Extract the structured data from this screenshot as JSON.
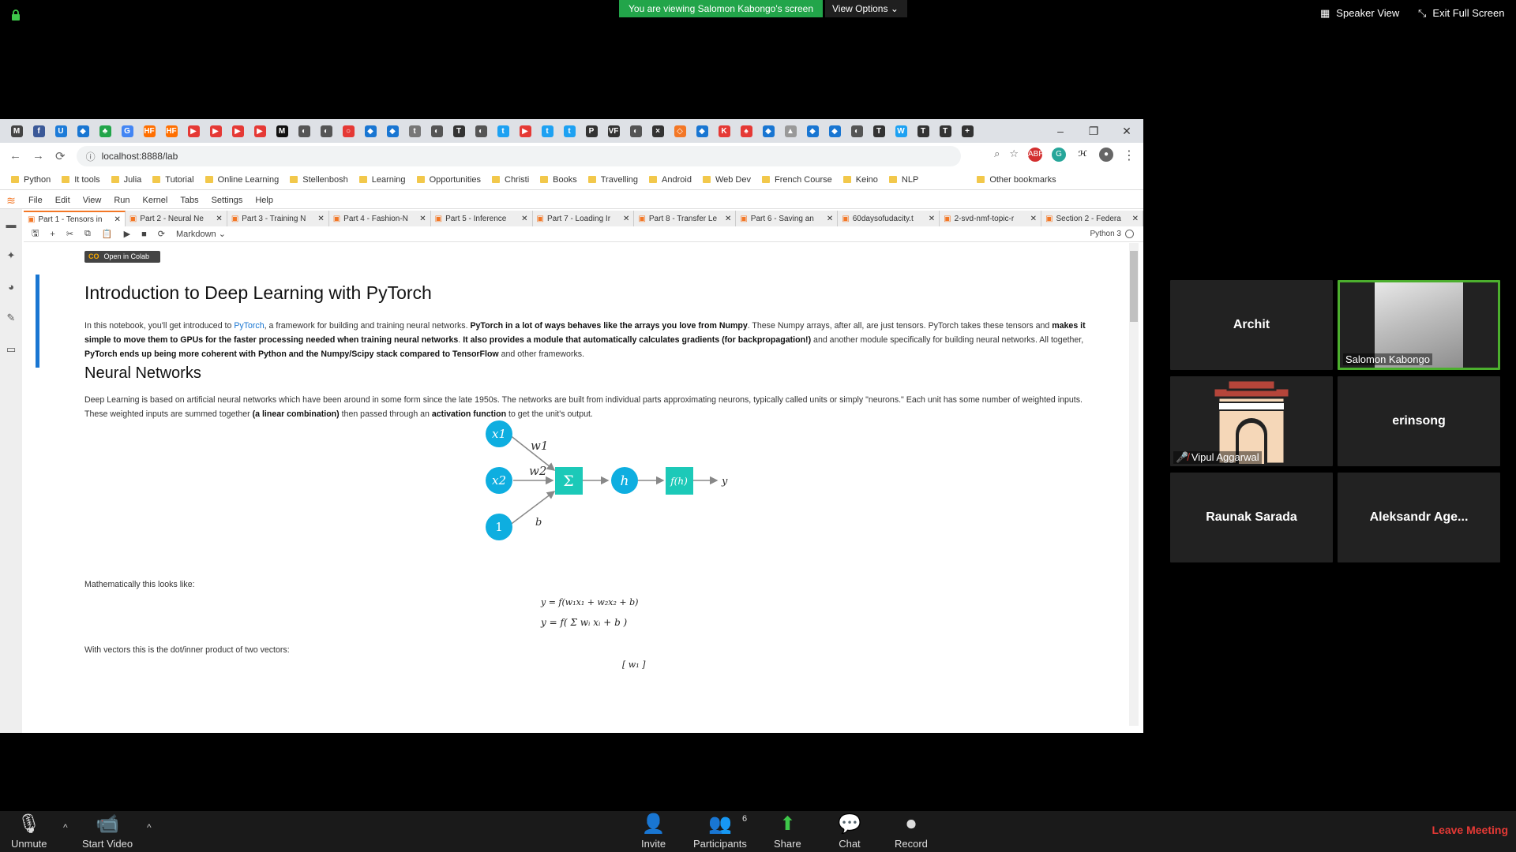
{
  "zoom": {
    "banner": "You are viewing Salomon Kabongo's screen",
    "view_options": "View Options",
    "speaker_view": "Speaker View",
    "exit_full_screen": "Exit Full Screen",
    "participants_count": "6",
    "controls": {
      "unmute": "Unmute",
      "start_video": "Start Video",
      "invite": "Invite",
      "participants": "Participants",
      "share": "Share",
      "chat": "Chat",
      "record": "Record",
      "leave": "Leave Meeting"
    },
    "gallery": [
      {
        "name": "Archit"
      },
      {
        "name": "Salomon Kabongo"
      },
      {
        "name": "Vipul Aggarwal"
      },
      {
        "name": "erinsong"
      },
      {
        "name": "Raunak Sarada"
      },
      {
        "name": "Aleksandr Age..."
      }
    ]
  },
  "browser": {
    "url": "localhost:8888/lab",
    "tab_icons": [
      "M",
      "f",
      "U",
      "◆",
      "♣",
      "G",
      "HF",
      "HF",
      "▶",
      "▶",
      "▶",
      "▶",
      "M",
      "◐",
      "◐",
      "○",
      "◆",
      "◆",
      "t",
      "◐",
      "T",
      "◐",
      "t",
      "▶",
      "t",
      "t",
      "P",
      "VF",
      "◐",
      "×",
      "◇",
      "◆",
      "K",
      "♠",
      "◆",
      "▲",
      "◆",
      "◆",
      "◐",
      "T",
      "W",
      "T",
      "T",
      "+"
    ],
    "bookmarks": [
      "Python",
      "It tools",
      "Julia",
      "Tutorial",
      "Online Learning",
      "Stellenbosh",
      "Learning",
      "Opportunities",
      "Christi",
      "Books",
      "Travelling",
      "Android",
      "Web Dev",
      "French Course",
      "Keino",
      "NLP"
    ],
    "other_bookmarks": "Other bookmarks"
  },
  "jupyter": {
    "menus": [
      "File",
      "Edit",
      "View",
      "Run",
      "Kernel",
      "Tabs",
      "Settings",
      "Help"
    ],
    "doc_tabs": [
      "Part 1 - Tensors in",
      "Part 2 - Neural Ne",
      "Part 3 - Training N",
      "Part 4 - Fashion-N",
      "Part 5 - Inference",
      "Part 7 - Loading Ir",
      "Part 8 - Transfer Le",
      "Part 6 - Saving an",
      "60daysofudacity.t",
      "2-svd-nmf-topic-r",
      "Section 2 - Federa"
    ],
    "cell_type": "Markdown",
    "kernel": "Python 3",
    "colab_badge": "Open in Colab",
    "title": "Introduction to Deep Learning with PyTorch",
    "intro": {
      "p1": "In this notebook, you'll get introduced to ",
      "link": "PyTorch",
      "p2": ", a framework for building and training neural networks. ",
      "b1": "PyTorch in a lot of ways behaves like the arrays you love from Numpy",
      "p3": ". These Numpy arrays, after all, are just tensors. PyTorch takes these tensors and ",
      "b2": "makes it simple to move them to GPUs for the faster processing needed when training neural networks",
      "p4": ". ",
      "b3": "It also provides a module that automatically calculates gradients (for backpropagation!)",
      "p5": " and another module specifically for building neural networks. All together, ",
      "b4": "PyTorch ends up being more coherent with Python and the Numpy/Scipy stack compared to TensorFlow",
      "p6": " and other frameworks."
    },
    "section_title": "Neural Networks",
    "nn": {
      "p1": "Deep Learning is based on artificial neural networks which have been around in some form since the late 1950s. The networks are built from individual parts approximating neurons, typically called units or simply \"neurons.\" Each unit has some number of weighted inputs. These weighted inputs are summed together ",
      "b1": "(a linear combination)",
      "p2": " then passed through an ",
      "b2": "activation function",
      "p3": " to get the unit's output."
    },
    "diagram": {
      "x1": "x1",
      "x2": "x2",
      "one": "1",
      "w1": "w1",
      "w2": "w2",
      "b": "b",
      "sum": "Σ",
      "h": "h",
      "fh": "f(h)",
      "y": "y"
    },
    "math_intro": "Mathematically this looks like:",
    "eq1": "y = f(w₁x₁ + w₂x₂ + b)",
    "eq2": "y = f( Σ wᵢ xᵢ + b )",
    "vectors_intro": "With vectors this is the dot/inner product of two vectors:",
    "vector_start": "[ w₁ ]"
  }
}
